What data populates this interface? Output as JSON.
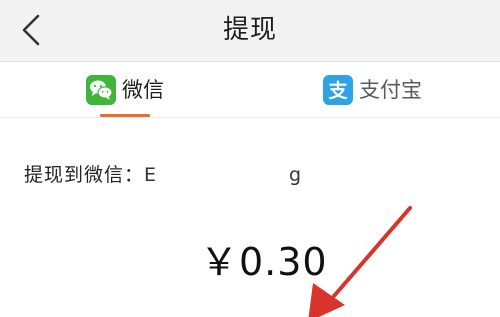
{
  "navbar": {
    "back_icon": "chevron-left-icon",
    "title": "提现"
  },
  "tabs": [
    {
      "label": "微信",
      "icon": "wechat-icon",
      "active": true
    },
    {
      "label": "支付宝",
      "icon": "alipay-icon",
      "active": false
    }
  ],
  "accent_color": "#e8702a",
  "withdraw": {
    "target_label": "提现到微信：",
    "account_start": "E",
    "account_end": "g"
  },
  "amount": "￥0.30",
  "annotation": {
    "type": "red-arrow",
    "color": "#d9342b"
  }
}
